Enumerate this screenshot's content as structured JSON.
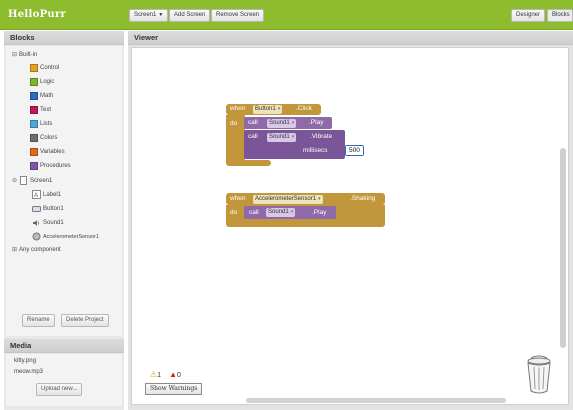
{
  "app": {
    "title": "HelloPurr"
  },
  "toolbar": {
    "screen_label": "Screen1",
    "add_screen": "Add Screen",
    "remove_screen": "Remove Screen",
    "designer": "Designer",
    "blocks": "Blocks"
  },
  "blocks_panel": {
    "title": "Blocks",
    "builtin": "Built-in",
    "builtin_items": [
      {
        "label": "Control",
        "color": "#e6a01c"
      },
      {
        "label": "Logic",
        "color": "#7fb52c"
      },
      {
        "label": "Math",
        "color": "#2d6cc0"
      },
      {
        "label": "Text",
        "color": "#c2185b"
      },
      {
        "label": "Lists",
        "color": "#4fa5d8"
      },
      {
        "label": "Colors",
        "color": "#6e6e6e"
      },
      {
        "label": "Variables",
        "color": "#e3681c"
      },
      {
        "label": "Procedures",
        "color": "#7e57a8"
      }
    ],
    "screen": "Screen1",
    "components": [
      "Label1",
      "Button1",
      "Sound1",
      "AccelerometerSensor1"
    ],
    "any_component": "Any component",
    "rename": "Rename",
    "delete_project": "Delete Project"
  },
  "media": {
    "title": "Media",
    "files": [
      "kitty.png",
      "meow.mp3"
    ],
    "upload": "Upload new..."
  },
  "viewer": {
    "title": "Viewer",
    "block1": {
      "when": "when",
      "component": "Button1",
      "event": ".Click",
      "do": "do",
      "call1": "call",
      "call1_component": "Sound1",
      "call1_method": ".Play",
      "call2": "call",
      "call2_component": "Sound1",
      "call2_method": ".Vibrate",
      "param": "millisecs",
      "value": "500"
    },
    "block2": {
      "when": "when",
      "component": "AccelerometerSensor1",
      "event": ".Shaking",
      "do": "do",
      "call": "call",
      "call_component": "Sound1",
      "call_method": ".Play"
    },
    "warnings_count": "1",
    "errors_count": "0",
    "show_warnings": "Show Warnings"
  }
}
